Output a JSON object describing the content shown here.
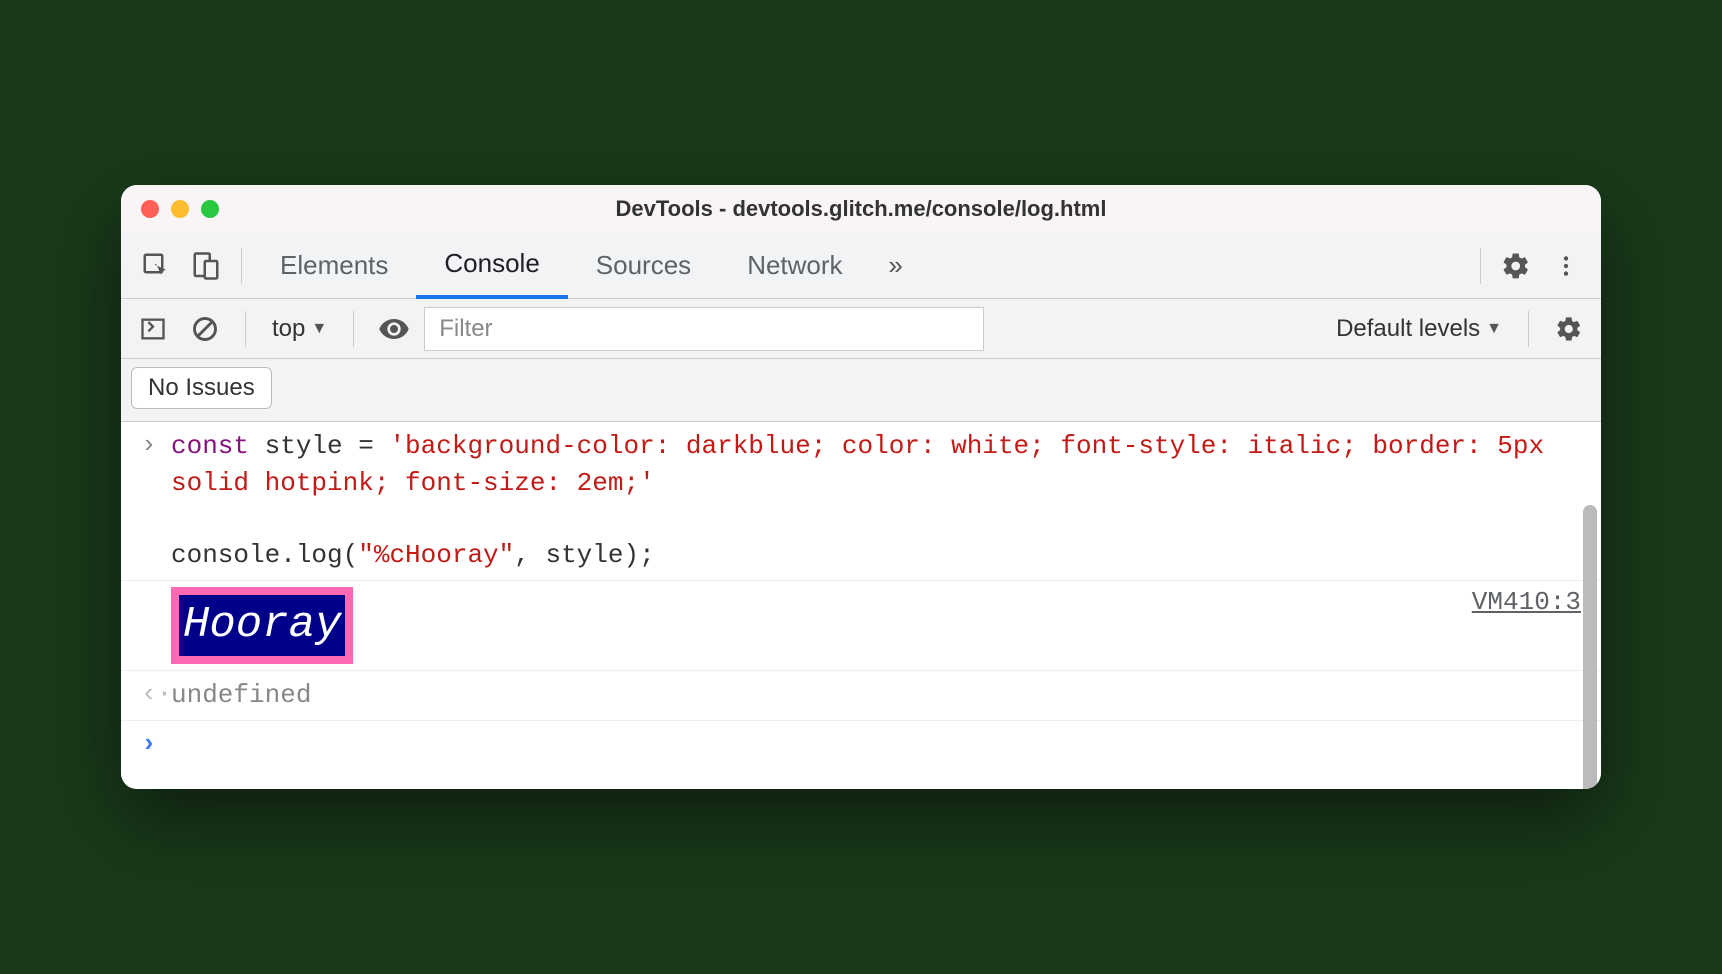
{
  "window": {
    "title": "DevTools - devtools.glitch.me/console/log.html"
  },
  "tabs": {
    "elements": "Elements",
    "console": "Console",
    "sources": "Sources",
    "network": "Network"
  },
  "toolbar": {
    "context": "top",
    "filter_placeholder": "Filter",
    "levels": "Default levels"
  },
  "issues": {
    "button": "No Issues"
  },
  "console": {
    "code_line1_kw": "const",
    "code_line1_rest": " style = ",
    "code_line1_str": "'background-color: darkblue; color: white; font-style: italic; border: 5px solid hotpink; font-size: 2em;'",
    "code_line2_a": "console.log(",
    "code_line2_str": "\"%cHooray\"",
    "code_line2_b": ", style);",
    "output_text": "Hooray",
    "output_source": "VM410:3",
    "return_value": "undefined"
  }
}
